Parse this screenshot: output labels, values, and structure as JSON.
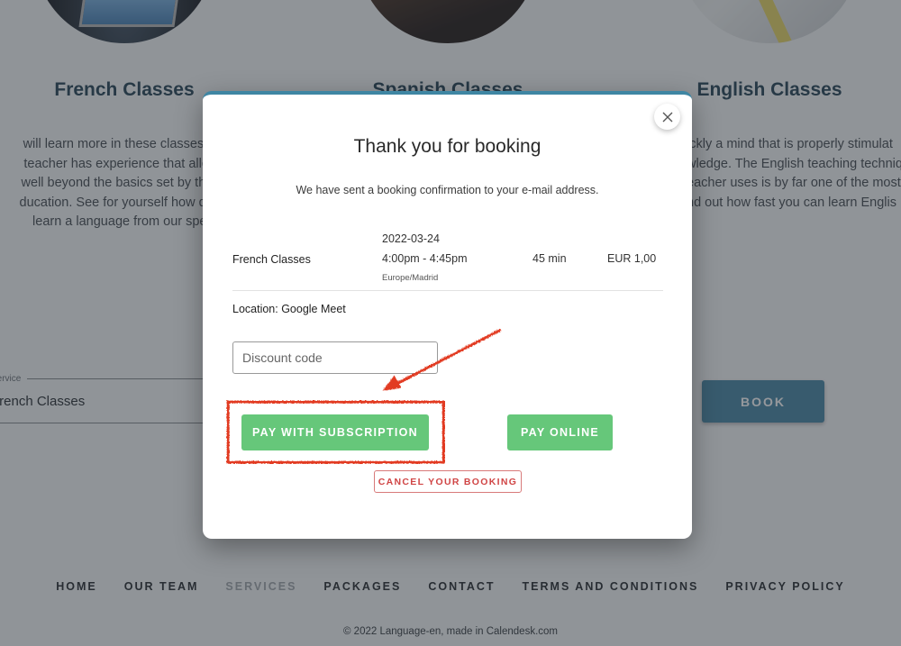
{
  "services": [
    {
      "title": "French Classes",
      "image_alt": "laptop-photo",
      "description_lines": [
        "will learn more in these classes tha",
        "teacher has experience that allows",
        "well beyond the basics set by the M",
        "ducation. See for yourself how quick",
        "learn a language from our speci"
      ]
    },
    {
      "title": "Spanish Classes",
      "image_alt": "classroom-photo",
      "description_lines": []
    },
    {
      "title": "English Classes",
      "image_alt": "desk-photo",
      "description_lines": [
        "ickly a mind that is properly stimulat",
        "wledge. The English teaching techniq",
        "eacher uses is by far one of the most",
        "nd out how fast you can learn Englis"
      ]
    }
  ],
  "booking_form": {
    "service_label": "Service",
    "service_value": "French Classes",
    "book_label": "BOOK"
  },
  "modal": {
    "title": "Thank you for booking",
    "subtitle": "We have sent a booking confirmation to your e-mail address.",
    "booking": {
      "service": "French Classes",
      "date": "2022-03-24",
      "time": "4:00pm - 4:45pm",
      "timezone": "Europe/Madrid",
      "duration": "45 min",
      "price": "EUR 1,00"
    },
    "location": "Location: Google Meet",
    "discount_placeholder": "Discount code",
    "pay_subscription_label": "PAY WITH SUBSCRIPTION",
    "pay_online_label": "PAY ONLINE",
    "cancel_label": "CANCEL YOUR BOOKING",
    "close_icon": "close-icon"
  },
  "footer": {
    "nav": [
      {
        "label": "HOME",
        "active": false
      },
      {
        "label": "OUR TEAM",
        "active": false
      },
      {
        "label": "SERVICES",
        "active": true
      },
      {
        "label": "PACKAGES",
        "active": false
      },
      {
        "label": "CONTACT",
        "active": false
      },
      {
        "label": "TERMS AND CONDITIONS",
        "active": false
      },
      {
        "label": "PRIVACY POLICY",
        "active": false
      }
    ],
    "copyright": "© 2022 Language-en, made in Calendesk.com"
  },
  "colors": {
    "accent": "#3f86a3",
    "pay_button": "#66c77a",
    "cancel": "#d04545",
    "annotation": "#e23a22"
  }
}
